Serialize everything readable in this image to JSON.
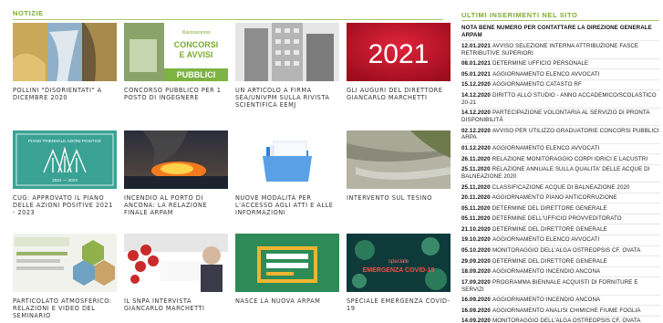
{
  "news": {
    "title": "NOTIZIE",
    "cards": [
      {
        "caption": "POLLINI \"DISORIENTATI\" A DICEMBRE 2020"
      },
      {
        "caption": "CONCORSO PUBBLICO PER 1 POSTO DI INGEGNERE",
        "thumb_text": [
          "CONCORSI",
          "E AVVISI",
          "PUBBLICI"
        ],
        "thumb_small": "#lavoraconnoi"
      },
      {
        "caption": "UN ARTICOLO A FIRMA SEA/UNIVPM SULLA RIVISTA SCIENTIFICA EEMJ"
      },
      {
        "caption": "GLI AUGURI DEL DIRETTORE GIANCARLO MARCHETTI",
        "thumb_text": "2021"
      },
      {
        "caption": "CUG: APPROVATO IL PIANO DELLE AZIONI POSITIVE 2021 - 2023",
        "thumb_text": "PIANO TRIENNALE AZIONI POSITIVE",
        "thumb_small": "2021 — 2023"
      },
      {
        "caption": "INCENDIO AL PORTO DI ANCONA: LA RELAZIONE FINALE ARPAM"
      },
      {
        "caption": "NUOVE MODALITÀ PER L'ACCESSO AGLI ATTI E ALLE INFORMAZIONI"
      },
      {
        "caption": "INTERVENTO SUL TESINO"
      },
      {
        "caption": "PARTICOLATO ATMOSFERICO: RELAZIONI E VIDEO DEL SEMINARIO"
      },
      {
        "caption": "IL SNPA INTERVISTA GIANCARLO MARCHETTI"
      },
      {
        "caption": "NASCE LA NUOVA ARPAM"
      },
      {
        "caption": "SPECIALE EMERGENZA COVID-19",
        "thumb_text": [
          "speciale",
          "EMERGENZA COVID-19"
        ]
      }
    ]
  },
  "latest": {
    "title": "ULTIMI INSERIMENTI NEL SITO",
    "first": "NOTA BENE NUMERO PER CONTATTARE LA DIREZIONE GENERALE ARPAM",
    "items": [
      {
        "date": "12.01.2021",
        "text": "AVVISO SELEZIONE INTERNA ATTRIBUZIONE FASCE RETRIBUTIVE SUPERIORI"
      },
      {
        "date": "08.01.2021",
        "text": "DETERMINE UFFICIO PERSONALE"
      },
      {
        "date": "05.01.2021",
        "text": "AGGIORNAMENTO ELENCO AVVOCATI"
      },
      {
        "date": "15.12.2020",
        "text": "AGGIORNAMENTO CATASTO RF"
      },
      {
        "date": "14.12.2020",
        "text": "DIRITTO ALLO STUDIO - ANNO ACCADEMICO/SCOLASTICO 20-21"
      },
      {
        "date": "14.12.2020",
        "text": "PARTECIPAZIONE VOLONTARIA AL SERVIZIO DI PRONTA DISPONIBILITÀ"
      },
      {
        "date": "02.12.2020",
        "text": "AVVISO PER UTILIZZO GRADUATORIE CONCORSI PUBBLICI ARPA"
      },
      {
        "date": "01.12.2020",
        "text": "AGGIORNAMENTO ELENCO AVVOCATI"
      },
      {
        "date": "26.11.2020",
        "text": "RELAZIONE MONITORAGGIO CORPI IDRICI E LACUSTRI"
      },
      {
        "date": "25.11.2020",
        "text": "RELAZIONE ANNUALE SULLA QUALITA' DELLE ACQUE DI BALNEAZIONE 2020"
      },
      {
        "date": "25.11.2020",
        "text": "CLASSIFICAZIONE ACQUE DI BALNEAZIONE 2020"
      },
      {
        "date": "20.11.2020",
        "text": "AGGIORNAMENTO PIANO ANTICORRUZIONE"
      },
      {
        "date": "05.11.2020",
        "text": "DETERMINE DEL DIRETTORE GENERALE"
      },
      {
        "date": "05.11.2020",
        "text": "DETERMINE DELL'UFFICIO PROVVEDITORATO"
      },
      {
        "date": "21.10.2020",
        "text": "DETERMINE DEL DIRETTORE GENERALE"
      },
      {
        "date": "19.10.2020",
        "text": "AGGIORNAMENTO ELENCO AVVOCATI"
      },
      {
        "date": "05.10.2020",
        "text": "MONITORAGGIO DELL'ALGA OSTREOPSIS CF. OVATA"
      },
      {
        "date": "29.09.2020",
        "text": "DETERMINE DEL DIRETTORE GENERALE"
      },
      {
        "date": "18.09.2020",
        "text": "AGGIORNAMENTO INCENDIO ANCONA"
      },
      {
        "date": "17.09.2020",
        "text": "PROGRAMMA BIENNALE ACQUISTI DI FORNITURE E SERVIZI"
      },
      {
        "date": "16.09.2020",
        "text": "AGGIORNAMENTO INCENDIO ANCONA"
      },
      {
        "date": "16.09.2020",
        "text": "AGGIORNAMENTO ANALISI CHIMICHE FIUME FOGLIA"
      },
      {
        "date": "14.09.2020",
        "text": "MONITORAGGIO DELL'ALGA OSTREOPSIS CF. OVATA"
      }
    ]
  },
  "colors": {
    "accent": "#7cad2e",
    "red": "#c8102e"
  }
}
